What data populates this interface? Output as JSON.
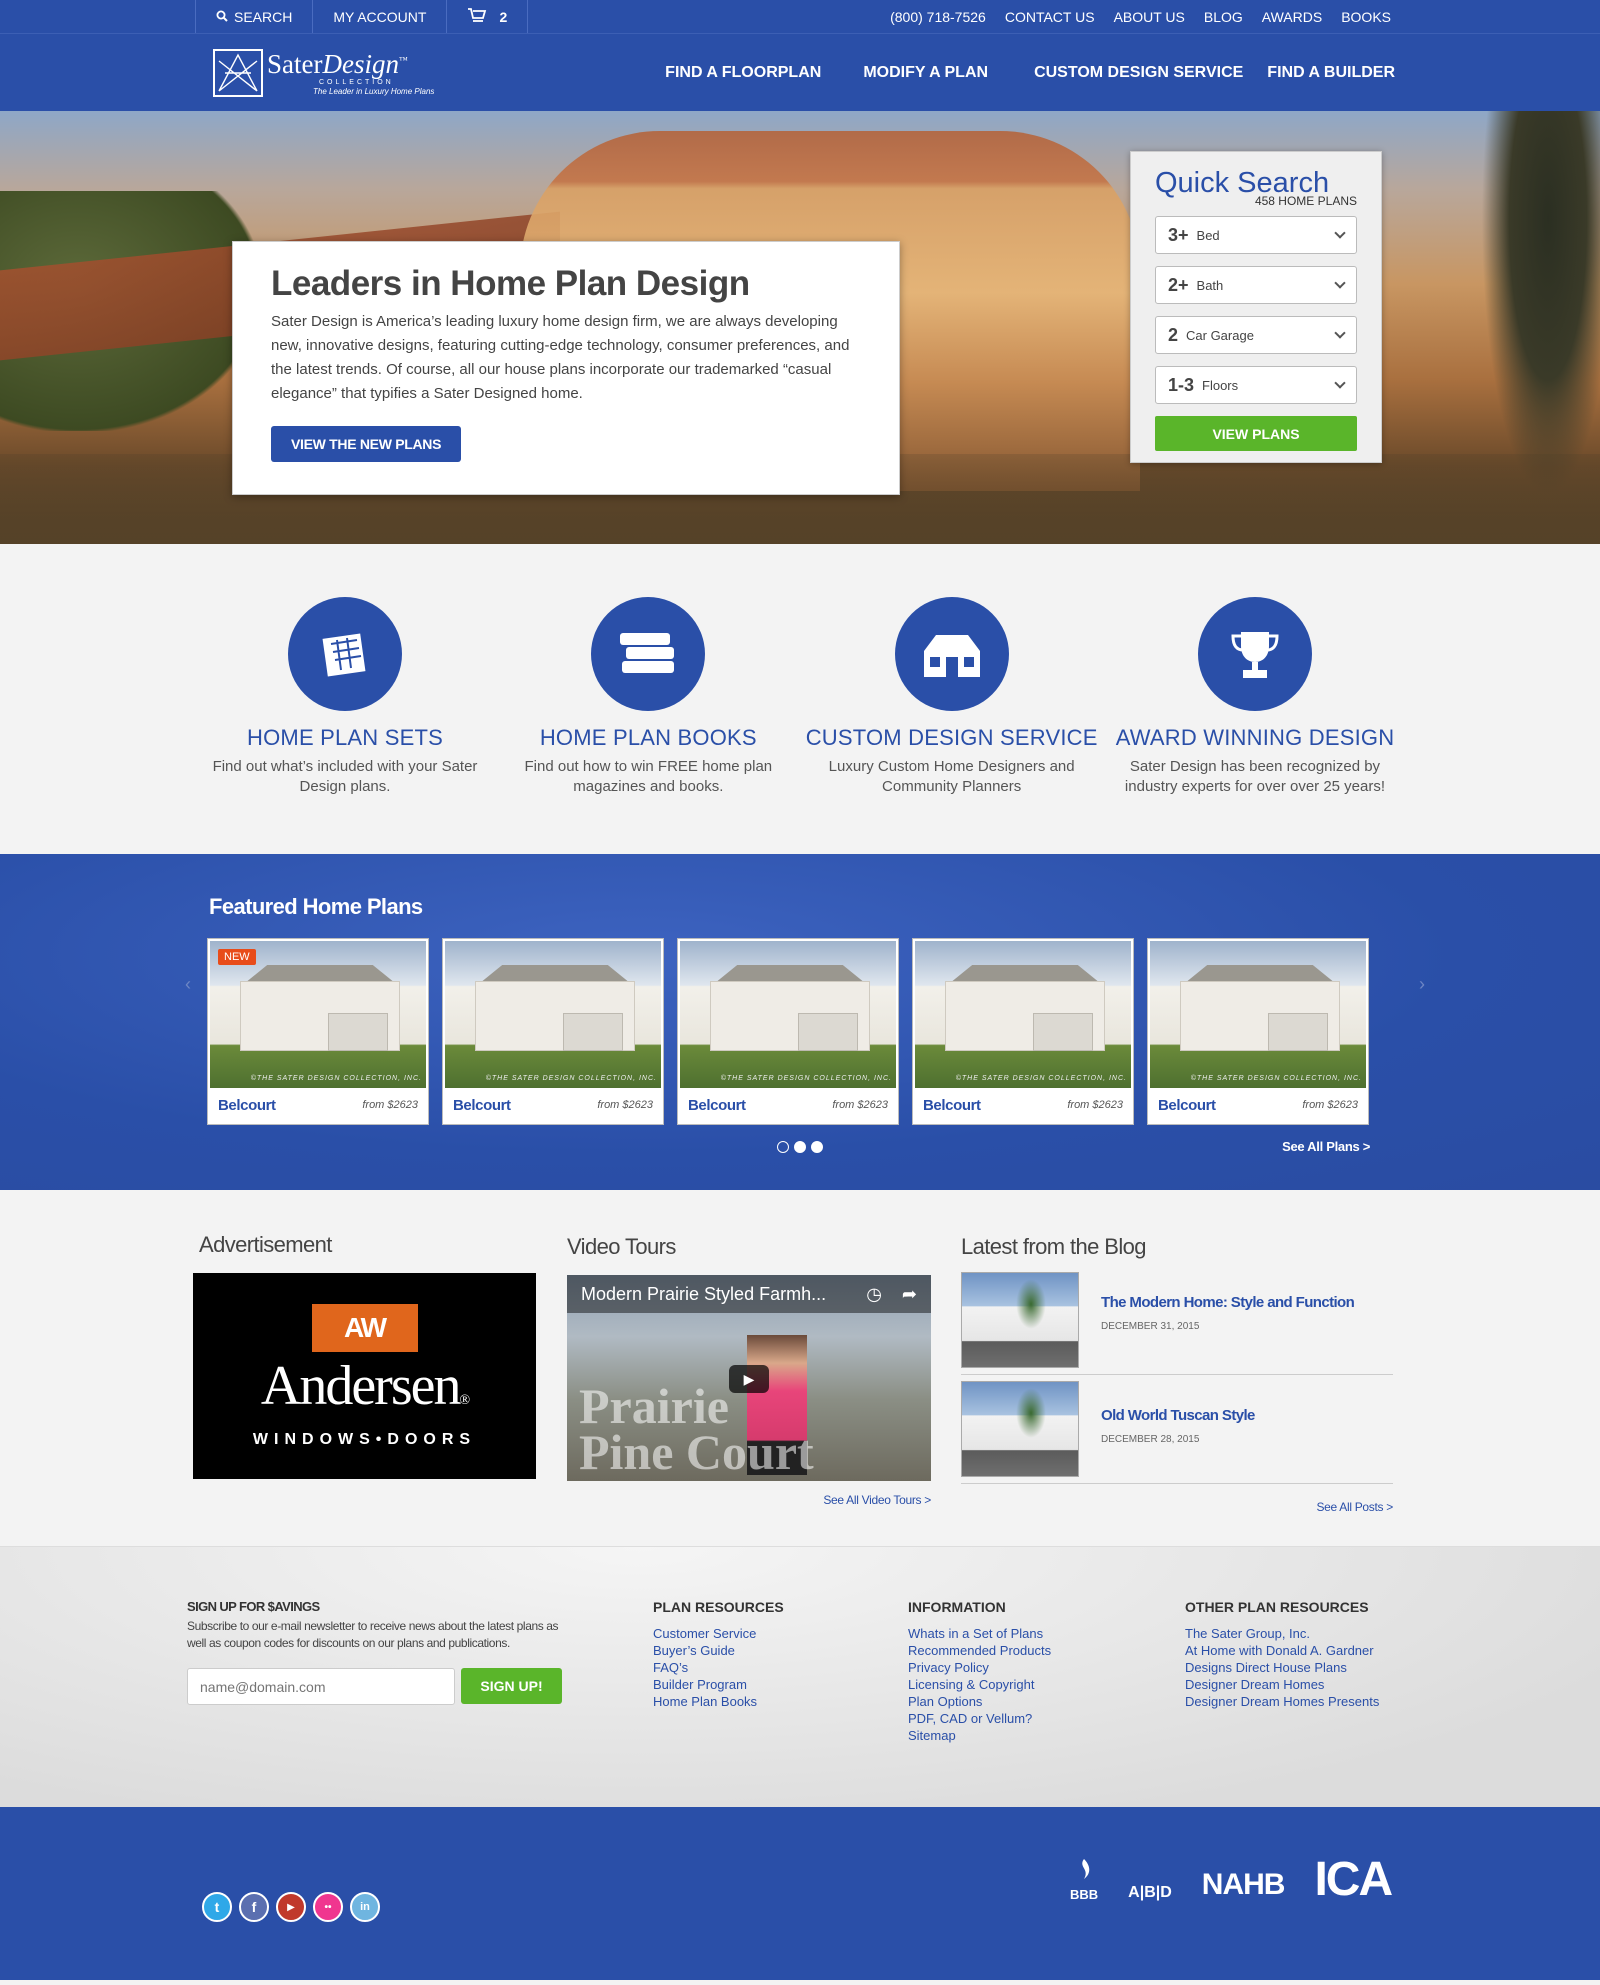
{
  "topbar": {
    "search": "SEARCH",
    "account": "MY ACCOUNT",
    "cart_count": "2",
    "phone": "(800) 718-7526",
    "links": [
      "CONTACT US",
      "ABOUT US",
      "BLOG",
      "AWARDS",
      "BOOKS"
    ]
  },
  "header": {
    "logo_name": "Sater",
    "logo_name_italic": "Design",
    "logo_tm": "™",
    "logo_collection": "COLLECTION",
    "logo_tagline": "The Leader in Luxury Home Plans",
    "nav": [
      "FIND A FLOORPLAN",
      "MODIFY A PLAN",
      "CUSTOM DESIGN SERVICE",
      "FIND A BUILDER"
    ]
  },
  "hero": {
    "title": "Leaders in Home Plan Design",
    "body": "Sater Design is America’s leading luxury home design firm, we are always developing new, innovative designs, featuring cutting-edge technology, consumer preferences, and the latest trends. Of course, all our house plans incorporate our trademarked “casual elegance” that typifies a Sater Designed home.",
    "button": "VIEW THE NEW PLANS"
  },
  "quick_search": {
    "title": "Quick Search",
    "count": "458 HOME PLANS",
    "selects": [
      {
        "value": "3+",
        "label": "Bed"
      },
      {
        "value": "2+",
        "label": "Bath"
      },
      {
        "value": "2",
        "label": "Car Garage"
      },
      {
        "value": "1-3",
        "label": "Floors"
      }
    ],
    "button": "VIEW PLANS"
  },
  "features": [
    {
      "title": "HOME PLAN SETS",
      "text": "Find out what’s included with your Sater Design plans.",
      "icon": "blueprint-icon"
    },
    {
      "title": "HOME PLAN BOOKS",
      "text": "Find out how to win FREE home plan magazines and books.",
      "icon": "books-icon"
    },
    {
      "title": "CUSTOM DESIGN SERVICE",
      "text": "Luxury Custom Home Designers and Community Planners",
      "icon": "house-icon"
    },
    {
      "title": "AWARD WINNING DESIGN",
      "text": "Sater Design has been recognized by industry experts for over over 25 years!",
      "icon": "trophy-icon"
    }
  ],
  "featured": {
    "title": "Featured Home Plans",
    "new_badge": "NEW",
    "watermark": "©THE SATER DESIGN COLLECTION, INC.",
    "plans": [
      {
        "name": "Belcourt",
        "price": "from $2623"
      },
      {
        "name": "Belcourt",
        "price": "from $2623"
      },
      {
        "name": "Belcourt",
        "price": "from $2623"
      },
      {
        "name": "Belcourt",
        "price": "from $2623"
      },
      {
        "name": "Belcourt",
        "price": "from $2623"
      }
    ],
    "see_all": "See All Plans >",
    "prev_arrow": "‹",
    "next_arrow": "›"
  },
  "middle": {
    "ad_title": "Advertisement",
    "ad_logo": "AW",
    "ad_brand": "Andersen",
    "ad_reg": "®",
    "ad_sub": "WINDOWS•DOORS",
    "video_title": "Video Tours",
    "video_caption": "Modern Prairie Styled Farmh...",
    "video_overlay_1": "Prairie",
    "video_overlay_2": "Pine Court",
    "video_see_all": "See All Video Tours >",
    "blog_title": "Latest from the Blog",
    "posts": [
      {
        "title": "The Modern Home: Style and Function",
        "date": "DECEMBER 31, 2015"
      },
      {
        "title": "Old World Tuscan Style",
        "date": "DECEMBER 28, 2015"
      }
    ],
    "blog_see_all": "See All Posts >"
  },
  "footer": {
    "signup_title": "SIGN UP FOR $AVINGS",
    "signup_text": "Subscribe to our e-mail newsletter to receive news about the latest plans as well as coupon codes for discounts on our plans and publications.",
    "email_placeholder": "name@domain.com",
    "signup_button": "SIGN UP!",
    "columns": [
      {
        "title": "PLAN RESOURCES",
        "links": [
          "Customer Service",
          "Buyer’s Guide",
          "FAQ’s",
          "Builder Program",
          "Home Plan Books"
        ]
      },
      {
        "title": "INFORMATION",
        "links": [
          "Whats in a Set of Plans",
          "Recommended Products",
          "Privacy Policy",
          "Licensing & Copyright",
          "Plan Options",
          "PDF, CAD or Vellum?",
          "Sitemap"
        ]
      },
      {
        "title": "OTHER PLAN RESOURCES",
        "links": [
          "The Sater Group, Inc.",
          "At Home with Donald A. Gardner",
          "Designs Direct House Plans",
          "Designer Dream Homes",
          "Designer Dream Homes Presents"
        ]
      }
    ]
  },
  "bottom": {
    "socials": [
      {
        "name": "twitter-icon",
        "glyph": "t",
        "color": "#2fa8e8"
      },
      {
        "name": "facebook-icon",
        "glyph": "f",
        "color": "#5b6fb0"
      },
      {
        "name": "youtube-icon",
        "glyph": "▶",
        "color": "#c0392b"
      },
      {
        "name": "flickr-icon",
        "glyph": "••",
        "color": "#f0368f"
      },
      {
        "name": "linkedin-icon",
        "glyph": "in",
        "color": "#6fb5e0"
      }
    ],
    "badges": {
      "bbb": "BBB",
      "abd": "A|B|D",
      "nahb": "NAHB",
      "ica": "ICA"
    }
  }
}
